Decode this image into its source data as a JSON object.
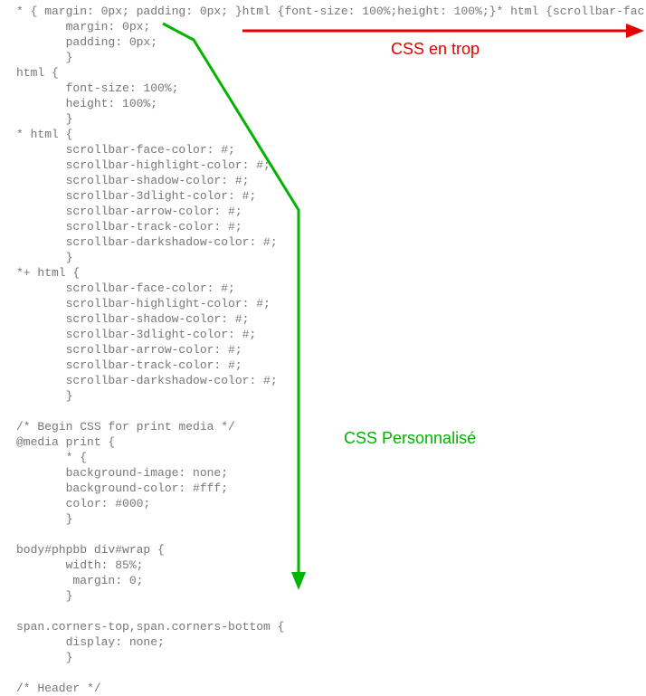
{
  "code": {
    "line1": "* { margin: 0px; padding: 0px; }html {font-size: 100%;height: 100%;}* html {scrollbar-fac",
    "block": "       margin: 0px;\n       padding: 0px;\n       }\nhtml {\n       font-size: 100%;\n       height: 100%;\n       }\n* html {\n       scrollbar-face-color: #;\n       scrollbar-highlight-color: #;\n       scrollbar-shadow-color: #;\n       scrollbar-3dlight-color: #;\n       scrollbar-arrow-color: #;\n       scrollbar-track-color: #;\n       scrollbar-darkshadow-color: #;\n       }\n*+ html {\n       scrollbar-face-color: #;\n       scrollbar-highlight-color: #;\n       scrollbar-shadow-color: #;\n       scrollbar-3dlight-color: #;\n       scrollbar-arrow-color: #;\n       scrollbar-track-color: #;\n       scrollbar-darkshadow-color: #;\n       }\n\n/* Begin CSS for print media */\n@media print {\n       * {\n       background-image: none;\n       background-color: #fff;\n       color: #000;\n       }\n\nbody#phpbb div#wrap {\n       width: 85%;\n        margin: 0;\n       }\n\nspan.corners-top,span.corners-bottom {\n       display: none;\n       }\n\n/* Header */"
  },
  "labels": {
    "excess": "CSS en trop",
    "custom": "CSS Personnalisé"
  },
  "colors": {
    "red": "#e60000",
    "green": "#00b400"
  }
}
